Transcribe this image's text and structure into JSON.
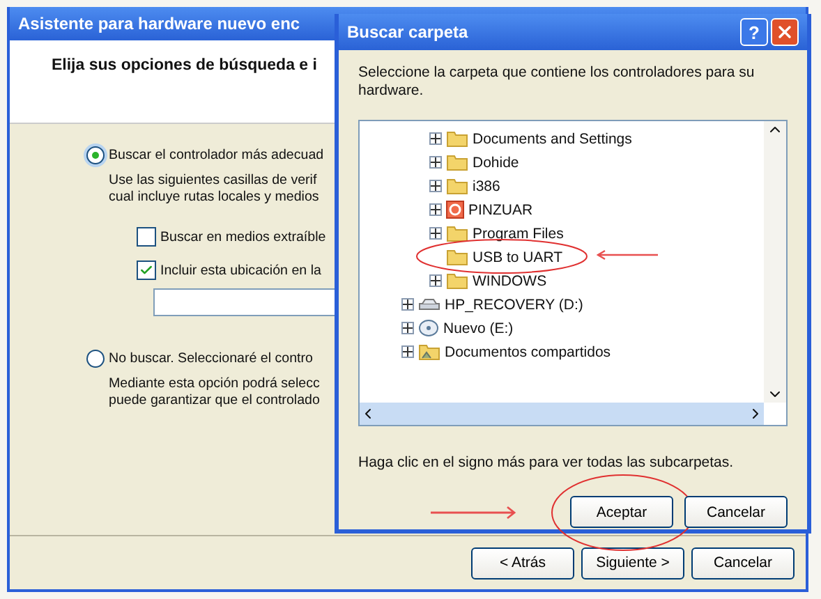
{
  "wizard": {
    "title": "Asistente para hardware nuevo enc",
    "heading": "Elija sus opciones de búsqueda e i",
    "options": [
      {
        "label": "Buscar el controlador más adecuad",
        "selected": true,
        "description": [
          "Use las siguientes casillas de verif",
          "cual incluye rutas locales y medios"
        ],
        "checkboxes": [
          {
            "label": "Buscar en medios extraíble",
            "checked": false
          },
          {
            "label": "Incluir esta ubicación en la",
            "checked": true
          }
        ],
        "path_field": true
      },
      {
        "label": "No buscar. Seleccionaré el contro",
        "selected": false,
        "description": [
          "Mediante esta opción podrá selecc",
          "puede garantizar que el controlado"
        ]
      }
    ],
    "buttons": [
      "< Atrás",
      "Siguiente >",
      "Cancelar"
    ]
  },
  "dialog": {
    "title": "Buscar carpeta",
    "help": "?",
    "prompt": "Seleccione la carpeta que contiene los controladores para su hardware.",
    "tree": [
      {
        "children": [
          {
            "label": "Documents and Settings",
            "kind": "folder",
            "expandable": true,
            "circled": false
          },
          {
            "label": "Dohide",
            "kind": "folder",
            "expandable": true,
            "circled": false
          },
          {
            "label": "i386",
            "kind": "folder",
            "expandable": true,
            "circled": false
          },
          {
            "label": "PINZUAR",
            "kind": "app",
            "expandable": true,
            "circled": false
          },
          {
            "label": "Program Files",
            "kind": "folder",
            "expandable": true,
            "circled": false
          },
          {
            "label": "USB to UART",
            "kind": "folder",
            "expandable": false,
            "circled": true
          },
          {
            "label": "WINDOWS",
            "kind": "folder",
            "expandable": true,
            "circled": false
          }
        ]
      },
      {
        "label": "HP_RECOVERY (D:)",
        "kind": "drive",
        "expandable": true,
        "circled": false
      },
      {
        "label": "Nuevo (E:)",
        "kind": "cdrom",
        "expandable": true,
        "circled": false
      },
      {
        "label": "Documentos compartidos",
        "kind": "shared",
        "expandable": true,
        "circled": false
      }
    ],
    "hint": "Haga clic en el signo más para ver todas las subcarpetas.",
    "buttons": [
      {
        "label": "Aceptar",
        "circled": true
      },
      {
        "label": "Cancelar",
        "circled": false
      }
    ]
  }
}
